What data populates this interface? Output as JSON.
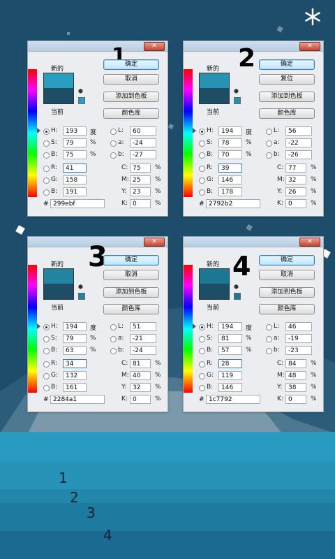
{
  "colors": {
    "bg": "#1d4d6a",
    "band_light": "#2a9bc0",
    "band_dark": "#1b6a92"
  },
  "decor": {
    "star_icon": "asterisk-icon"
  },
  "panels": [
    {
      "numeral": "1",
      "new_label": "新的",
      "current_label": "当前",
      "new_color": "#299ebf",
      "current_color": "#1d4e66",
      "buttons": [
        "确定",
        "取消",
        "添加到色板",
        "颜色库"
      ],
      "H": "193",
      "S": "79",
      "B": "75",
      "R": "41",
      "G": "158",
      "Bv": "191",
      "L": "60",
      "a": "-24",
      "b": "-27",
      "C": "75",
      "M": "25",
      "Y": "23",
      "K": "0",
      "hex": "299ebf",
      "unit_deg": "度",
      "pct": "%",
      "hash": "#"
    },
    {
      "numeral": "2",
      "new_label": "新的",
      "current_label": "当前",
      "new_color": "#2792b2",
      "current_color": "#1d4e66",
      "buttons": [
        "确定",
        "复位",
        "添加到色板",
        "颜色库"
      ],
      "H": "194",
      "S": "78",
      "B": "70",
      "R": "39",
      "G": "146",
      "Bv": "178",
      "L": "56",
      "a": "-22",
      "b": "-26",
      "C": "77",
      "M": "32",
      "Y": "26",
      "K": "0",
      "hex": "2792b2",
      "unit_deg": "度",
      "pct": "%",
      "hash": "#"
    },
    {
      "numeral": "3",
      "new_label": "新的",
      "current_label": "当前",
      "new_color": "#2284a1",
      "current_color": "#1d4e66",
      "buttons": [
        "确定",
        "取消",
        "添加到色板",
        "颜色库"
      ],
      "H": "194",
      "S": "79",
      "B": "63",
      "R": "34",
      "G": "132",
      "Bv": "161",
      "L": "51",
      "a": "-21",
      "b": "-24",
      "C": "81",
      "M": "40",
      "Y": "32",
      "K": "0",
      "hex": "2284a1",
      "unit_deg": "度",
      "pct": "%",
      "hash": "#"
    },
    {
      "numeral": "4",
      "new_label": "新的",
      "current_label": "当前",
      "new_color": "#1c7792",
      "current_color": "#1d4e66",
      "buttons": [
        "确定",
        "取消",
        "添加到色板",
        "颜色库"
      ],
      "H": "194",
      "S": "81",
      "B": "57",
      "R": "28",
      "G": "119",
      "Bv": "146",
      "L": "46",
      "a": "-19",
      "b": "-23",
      "C": "84",
      "M": "48",
      "Y": "38",
      "K": "0",
      "hex": "1c7792",
      "unit_deg": "度",
      "pct": "%",
      "hash": "#"
    }
  ],
  "bottom_numbers": [
    "1",
    "2",
    "3",
    "4"
  ]
}
